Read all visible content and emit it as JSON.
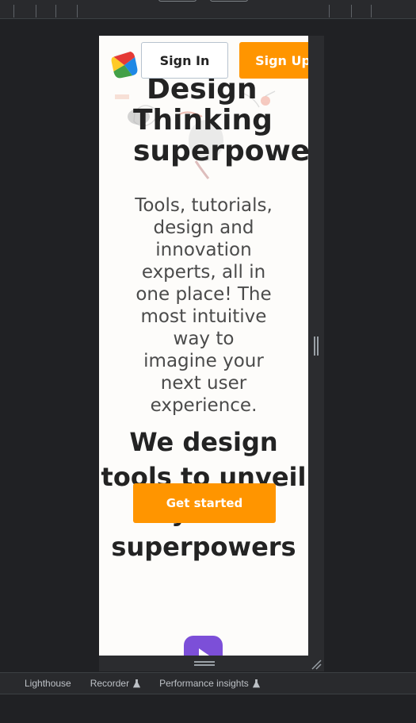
{
  "header": {
    "sign_in_label": "Sign In",
    "sign_up_label": "Sign Up"
  },
  "hero": {
    "title_line1": "Design",
    "title_line2": "Thinking",
    "title_line3": "superpowers",
    "subtitle": "Tools, tutorials, design and innovation experts, all in one place! The most intuitive way to imagine your next user experience."
  },
  "section": {
    "title": "We design tools to unveil your superpowers"
  },
  "cta": {
    "label": "Get started"
  },
  "devtools": {
    "tabs": [
      {
        "label": "Lighthouse",
        "experimental": false
      },
      {
        "label": "Recorder",
        "experimental": true
      },
      {
        "label": "Performance insights",
        "experimental": true
      }
    ]
  },
  "colors": {
    "accent": "#ff9500",
    "play_button": "#7c4fd8",
    "text_dark": "#232323",
    "devtools_bg": "#202124"
  }
}
